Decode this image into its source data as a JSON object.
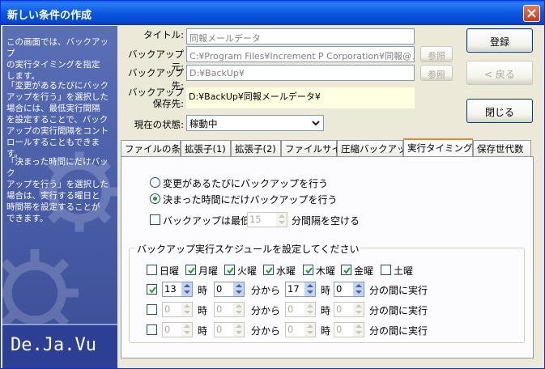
{
  "window": {
    "title": "新しい条件の作成"
  },
  "sidebar": {
    "paragraphs": [
      [
        "この画面では、バックアップ",
        "の実行タイミングを指定",
        "します。"
      ],
      [
        "「変更があるたびにバック",
        "アップを行う」を選択した",
        "場合には、最低実行間隔",
        "を設定することで、バック",
        "アップの実行間隔をコント",
        "ロールすることもできます。"
      ],
      [
        "「決まった時間にだけバック",
        "アップを行う」を選択した",
        "場合は、実行する曜日と",
        "時間帯を設定することが",
        "できます。"
      ]
    ],
    "logo": "De.Ja.Vu"
  },
  "form": {
    "title_label": "タイトル:",
    "title_value": "同報メールデータ",
    "source_label": "バックアップ元:",
    "source_value": "C:¥Program Files¥Increment P Corporation¥同報@メー",
    "dest_label": "バックアップ先:",
    "dest_value": "D:¥BackUp¥",
    "save_label_1": "バックアップ",
    "save_label_2": "保存先:",
    "save_value": "D:¥BackUp¥同報メールデータ¥",
    "status_label": "現在の状態:",
    "status_value": "稼動中",
    "browse_label": "参照"
  },
  "buttons": {
    "register": "登録",
    "back": "< 戻る",
    "close": "閉じる"
  },
  "tabs": [
    {
      "label": "ファイルの条件",
      "active": false
    },
    {
      "label": "拡張子(1)",
      "active": false
    },
    {
      "label": "拡張子(2)",
      "active": false
    },
    {
      "label": "ファイルサイズ",
      "active": false
    },
    {
      "label": "圧縮バックアップ",
      "active": false
    },
    {
      "label": "実行タイミング",
      "active": true
    },
    {
      "label": "保存世代数",
      "active": false
    }
  ],
  "timing": {
    "option_on_change": "変更があるたびにバックアップを行う",
    "option_scheduled": "決まった時間にだけバックアップを行う",
    "selected": "scheduled",
    "interval_prefix": "バックアップは最低",
    "interval_value": "15",
    "interval_suffix": "分間隔を空ける",
    "schedule_title": "バックアップ実行スケジュールを設定してください",
    "weekdays": [
      {
        "label": "日曜",
        "checked": false
      },
      {
        "label": "月曜",
        "checked": true
      },
      {
        "label": "火曜",
        "checked": true
      },
      {
        "label": "水曜",
        "checked": true
      },
      {
        "label": "木曜",
        "checked": true
      },
      {
        "label": "金曜",
        "checked": true
      },
      {
        "label": "土曜",
        "checked": false
      }
    ],
    "hour_label": "時",
    "from_label": "分から",
    "until_label": "分の間に実行",
    "rows": [
      {
        "enabled": true,
        "start_h": "13",
        "start_m": "0",
        "end_h": "17",
        "end_m": "0"
      },
      {
        "enabled": false,
        "start_h": "0",
        "start_m": "0",
        "end_h": "0",
        "end_m": "0"
      },
      {
        "enabled": false,
        "start_h": "0",
        "start_m": "0",
        "end_h": "0",
        "end_m": "0"
      }
    ]
  }
}
